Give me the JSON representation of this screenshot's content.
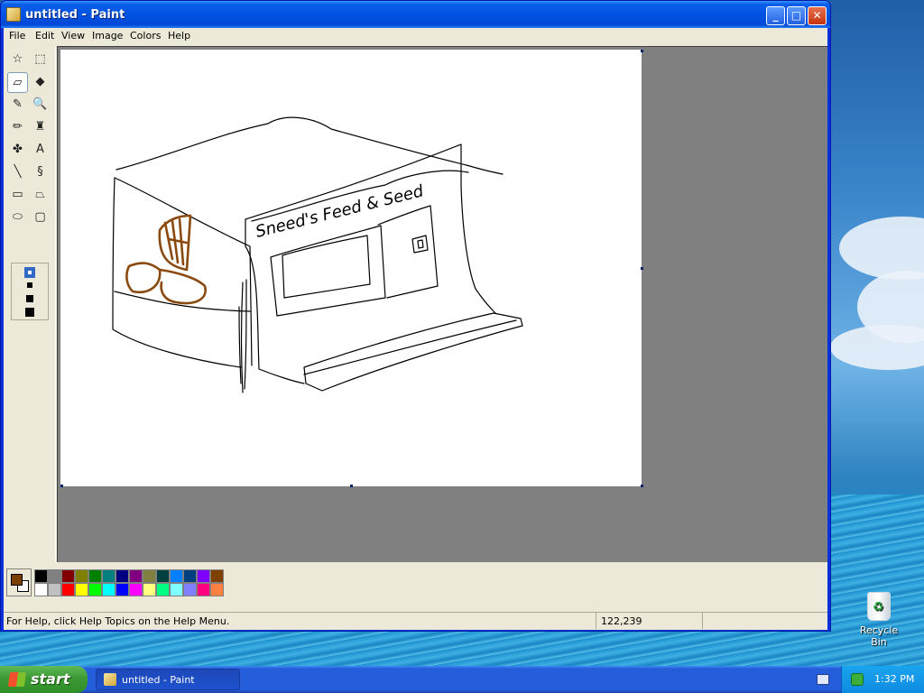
{
  "window": {
    "title": "untitled - Paint"
  },
  "menu": [
    "File",
    "Edit",
    "View",
    "Image",
    "Colors",
    "Help"
  ],
  "tools": [
    {
      "name": "free-form-select",
      "glyph": "☆"
    },
    {
      "name": "rectangle-select",
      "glyph": "⬚"
    },
    {
      "name": "eraser",
      "glyph": "▱"
    },
    {
      "name": "fill-with-color",
      "glyph": "◆"
    },
    {
      "name": "pick-color",
      "glyph": "✎"
    },
    {
      "name": "magnifier",
      "glyph": "🔍"
    },
    {
      "name": "pencil",
      "glyph": "✏"
    },
    {
      "name": "brush",
      "glyph": "♜"
    },
    {
      "name": "airbrush",
      "glyph": "✤"
    },
    {
      "name": "text",
      "glyph": "A"
    },
    {
      "name": "line",
      "glyph": "╲"
    },
    {
      "name": "curve",
      "glyph": "§"
    },
    {
      "name": "rectangle",
      "glyph": "▭"
    },
    {
      "name": "polygon",
      "glyph": "⏢"
    },
    {
      "name": "ellipse",
      "glyph": "⬭"
    },
    {
      "name": "rounded-rectangle",
      "glyph": "▢"
    }
  ],
  "active_tool": "eraser",
  "palette": {
    "row1": [
      "#000000",
      "#808080",
      "#800000",
      "#808000",
      "#008000",
      "#008080",
      "#000080",
      "#800080",
      "#808040",
      "#004040",
      "#0080ff",
      "#004080",
      "#8000ff",
      "#804000"
    ],
    "row2": [
      "#ffffff",
      "#c0c0c0",
      "#ff0000",
      "#ffff00",
      "#00ff00",
      "#00ffff",
      "#0000ff",
      "#ff00ff",
      "#ffff80",
      "#00ff80",
      "#80ffff",
      "#8080ff",
      "#ff0080",
      "#ff8040"
    ],
    "foreground": "#7b3f00",
    "background": "#ffffff"
  },
  "drawing_text": "Sneed's Feed & Seed",
  "status": {
    "help": "For Help, click Help Topics on the Help Menu.",
    "coords": "122,239"
  },
  "taskbar": {
    "start": "start",
    "task": "untitled - Paint",
    "clock": "1:32 PM"
  },
  "desktop": {
    "recycle_bin": "Recycle Bin"
  },
  "colors": {
    "titlebar": "#0054e3",
    "taskbar": "#245edb",
    "start": "#3c9a34"
  }
}
